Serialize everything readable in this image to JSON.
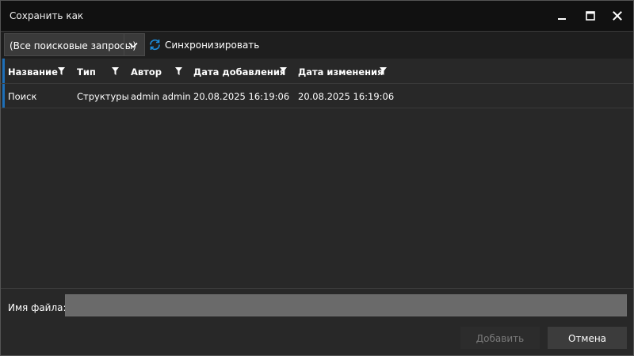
{
  "window": {
    "title": "Сохранить как",
    "controls": {
      "minimize_icon": "minimize-icon",
      "maximize_icon": "maximize-icon",
      "close_icon": "close-icon"
    }
  },
  "toolbar": {
    "query_select": {
      "value": "(Все поисковые запросы)",
      "icon": "chevron-down-icon"
    },
    "sync_button": {
      "label": "Синхронизировать",
      "icon": "sync-icon",
      "icon_color": "#1d8fe0"
    }
  },
  "grid": {
    "accent_color": "#1d6fb8",
    "columns": [
      {
        "key": "name",
        "label": "Название"
      },
      {
        "key": "type",
        "label": "Тип"
      },
      {
        "key": "author",
        "label": "Автор"
      },
      {
        "key": "added",
        "label": "Дата добавления"
      },
      {
        "key": "modified",
        "label": "Дата изменения"
      }
    ],
    "filter_icon": "filter-icon",
    "rows": [
      {
        "name": "Поиск",
        "type": "Структуры",
        "author": "admin admin",
        "added": "20.08.2025 16:19:06",
        "modified": "20.08.2025 16:19:06"
      }
    ]
  },
  "footer": {
    "file_name_label": "Имя файла:",
    "file_name_value": "",
    "add_button": "Добавить",
    "cancel_button": "Отмена"
  }
}
